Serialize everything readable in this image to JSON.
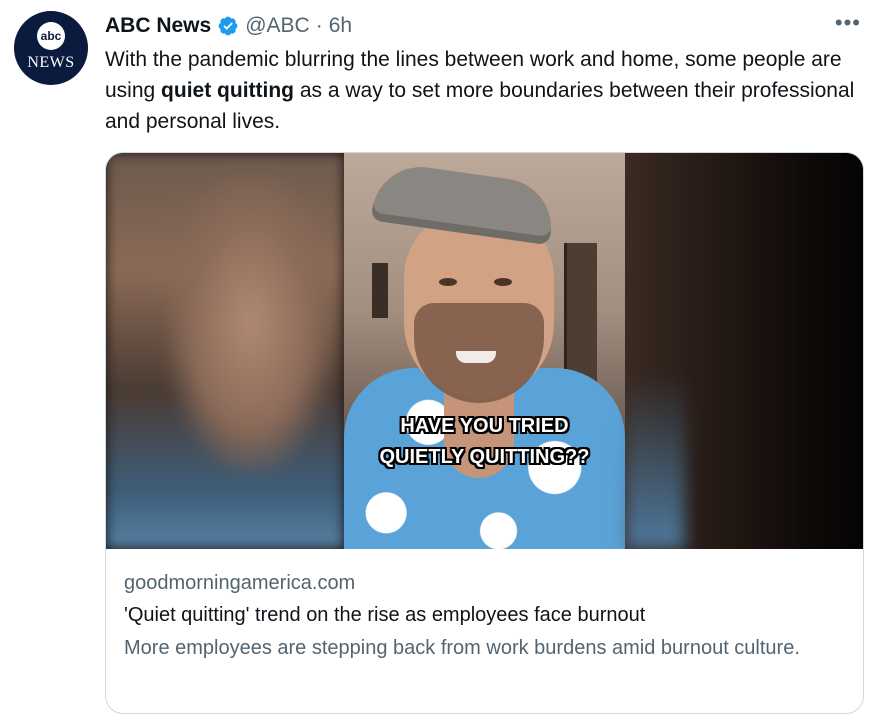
{
  "author": {
    "avatar_text_logo": "abc",
    "avatar_text_word": "NEWS",
    "name": "ABC News",
    "handle": "@ABC",
    "separator": "·",
    "time": "6h",
    "verified_color": "#1d9bf0"
  },
  "more_label": "•••",
  "tweet": {
    "text_before": "With the pandemic blurring the lines between work and home, some people are using ",
    "text_bold": "quiet quitting",
    "text_after": " as a way to set more boundaries between their professional and personal lives."
  },
  "card": {
    "video_caption_line1": "HAVE YOU TRIED",
    "video_caption_line2": "QUIETLY QUITTING??",
    "domain": "goodmorningamerica.com",
    "title": "'Quiet quitting' trend on the rise as employees face burnout",
    "description": "More employees are stepping back from work burdens amid burnout culture."
  },
  "colors": {
    "text_primary": "#0f1419",
    "text_secondary": "#536471",
    "border": "#cfd9de",
    "avatar_bg": "#0b1b3d"
  }
}
